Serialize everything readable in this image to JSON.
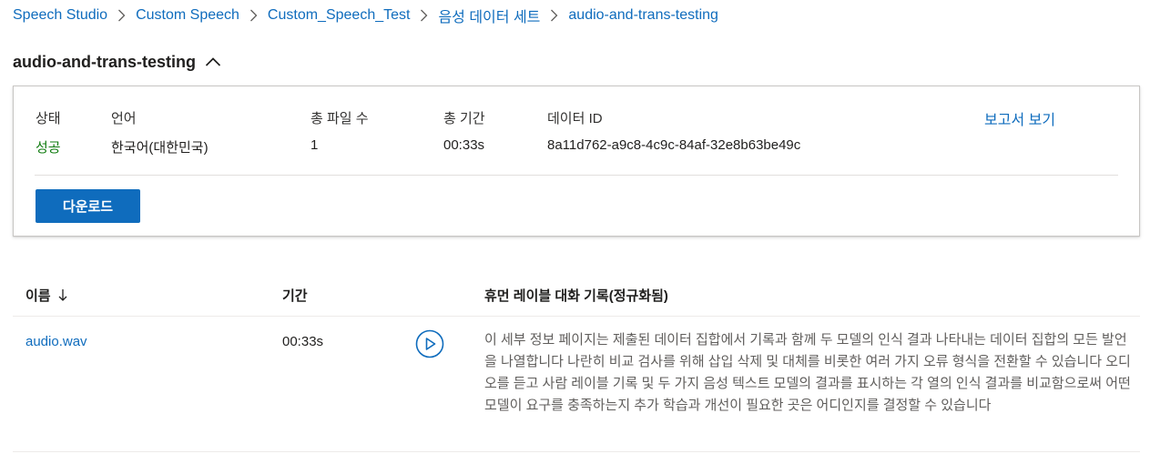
{
  "breadcrumb": {
    "items": [
      "Speech Studio",
      "Custom Speech",
      "Custom_Speech_Test",
      "음성 데이터 세트",
      "audio-and-trans-testing"
    ]
  },
  "title": {
    "text": "audio-and-trans-testing",
    "toggle_icon": "chevron-up-icon"
  },
  "details": {
    "status_label": "상태",
    "status_value": "성공",
    "language_label": "언어",
    "language_value": "한국어(대한민국)",
    "file_count_label": "총 파일 수",
    "file_count_value": "1",
    "duration_label": "총 기간",
    "duration_value": "00:33s",
    "data_id_label": "데이터 ID",
    "data_id_value": "8a11d762-a9c8-4c9c-84af-32e8b63be49c",
    "report_link": "보고서 보기",
    "download_label": "다운로드"
  },
  "table": {
    "headers": {
      "name": "이름",
      "name_sort_icon": "arrow-down-icon",
      "duration": "기간",
      "transcript": "휴먼 레이블 대화 기록(정규화됨)"
    },
    "rows": [
      {
        "name": "audio.wav",
        "duration": "00:33s",
        "action_icon": "play-icon",
        "transcript": "이 세부 정보 페이지는 제출된 데이터 집합에서 기록과 함께 두 모델의 인식 결과 나타내는 데이터 집합의 모든 발언을 나열합니다 나란히 비교 검사를 위해 삽입 삭제 및 대체를 비롯한 여러 가지 오류 형식을 전환할 수 있습니다 오디오를 듣고 사람 레이블 기록 및 두 가지 음성 텍스트 모델의 결과를 표시하는 각 열의 인식 결과를 비교함으로써 어떤 모델이 요구를 충족하는지 추가 학습과 개선이 필요한 곳은 어디인지를 결정할 수 있습니다"
      }
    ]
  },
  "colors": {
    "link": "#0f6cbd",
    "success": "#107c10",
    "primary_button": "#0f6cbd",
    "text": "#201f1e",
    "secondary_text": "#605e5c"
  }
}
